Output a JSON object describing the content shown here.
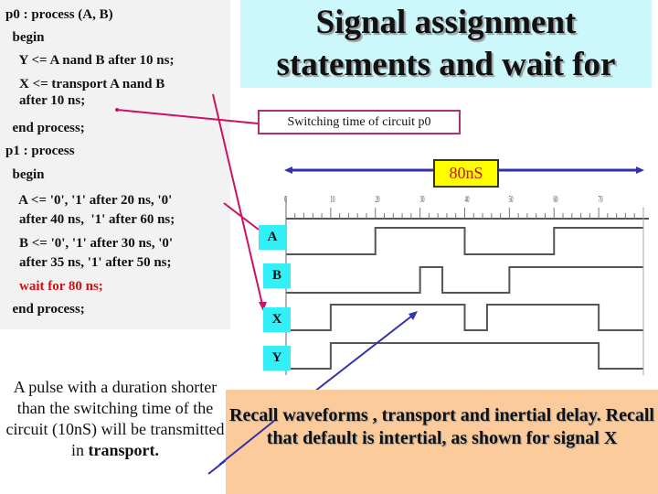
{
  "code": {
    "lines": [
      "p0 : process (A, B)",
      "  begin",
      "    Y <= A nand B after 10 ns;",
      "    X <= transport A nand B",
      "    after 10 ns;",
      "  end process;",
      "p1 : process",
      "  begin",
      "    A <= '0', '1' after 20 ns, '0'",
      "    after 40 ns,  '1' after 60 ns;",
      "    B <= '0', '1' after 30 ns, '0'",
      "    after 35 ns, '1' after 50 ns;",
      "    wait for 80 ns;",
      "  end process;"
    ],
    "highlight_color": "#cc1111"
  },
  "title": {
    "line1": "Signal assignment",
    "line2": "statements and wait for"
  },
  "annotations": {
    "switching_time": "Switching time of circuit p0",
    "duration": "80nS",
    "pulse_note_plain": "A pulse with a duration shorter than the switching time of the circuit (10nS) will be transmitted in",
    "pulse_note_bold": "transport.",
    "recall": "Recall waveforms , transport and inertial delay. Recall that default is intertial, as shown for signal X"
  },
  "waveform": {
    "time_unit": "ns",
    "time_range": [
      0,
      80
    ],
    "tick_labels": [
      "0",
      "10",
      "20",
      "30",
      "40",
      "50",
      "60",
      "70"
    ],
    "signals": [
      {
        "name": "A",
        "transitions": [
          [
            0,
            0
          ],
          [
            20,
            1
          ],
          [
            40,
            0
          ],
          [
            60,
            1
          ]
        ]
      },
      {
        "name": "B",
        "transitions": [
          [
            0,
            0
          ],
          [
            30,
            1
          ],
          [
            35,
            0
          ],
          [
            50,
            1
          ]
        ]
      },
      {
        "name": "X",
        "transitions": [
          [
            0,
            0
          ],
          [
            10,
            1
          ],
          [
            40,
            0
          ],
          [
            45,
            1
          ],
          [
            70,
            0
          ]
        ]
      },
      {
        "name": "Y",
        "transitions": [
          [
            0,
            0
          ],
          [
            10,
            1
          ],
          [
            70,
            0
          ]
        ]
      }
    ]
  },
  "colors": {
    "title_bg": "#ccf8fc",
    "signal_label_bg": "#33f0f8",
    "duration_bg": "#ffff00",
    "recall_bg": "#fccb9c",
    "pointer_magenta": "#cc1166",
    "pointer_blue": "#3333aa"
  }
}
